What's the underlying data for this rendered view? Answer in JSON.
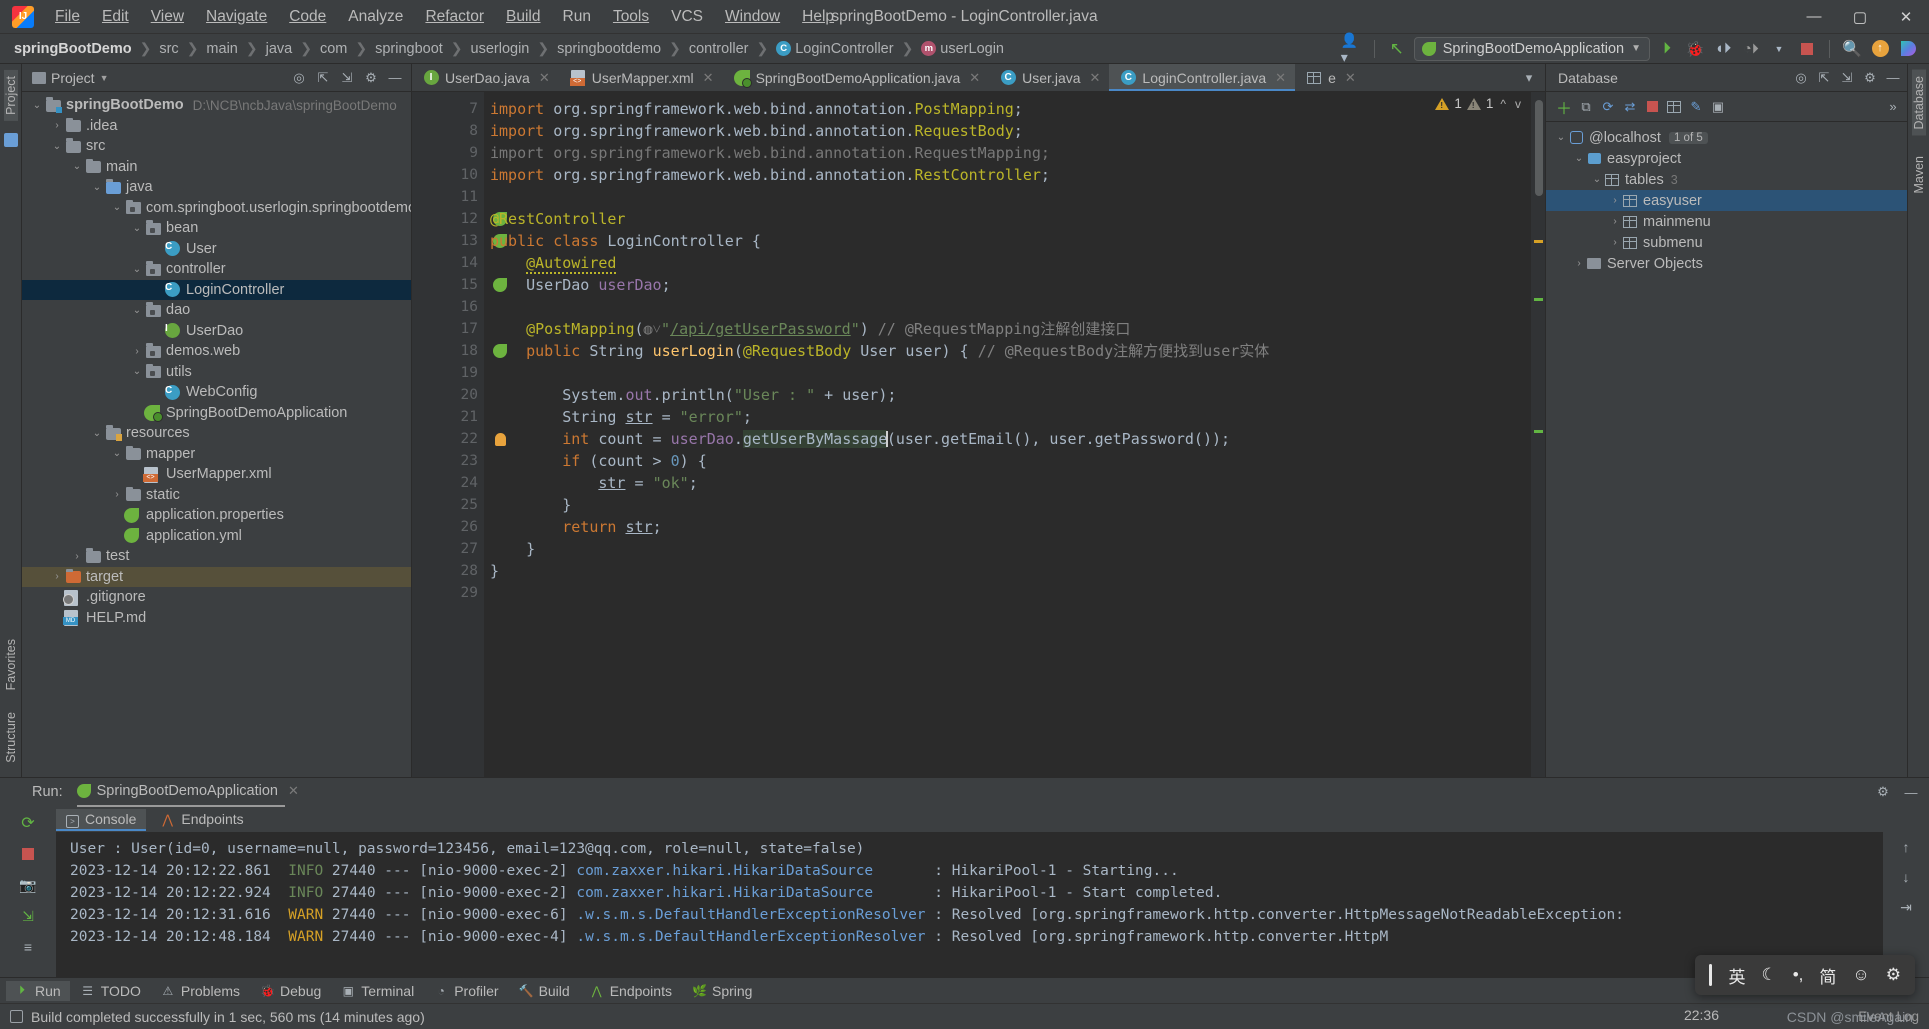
{
  "titlebar": {
    "window_title": "springBootDemo - LoginController.java",
    "menus": [
      "File",
      "Edit",
      "View",
      "Navigate",
      "Code",
      "Analyze",
      "Refactor",
      "Build",
      "Run",
      "Tools",
      "VCS",
      "Window",
      "Help"
    ],
    "controls": {
      "minimize": "—",
      "maximize": "▢",
      "close": "✕"
    }
  },
  "navbar": {
    "crumbs": [
      "springBootDemo",
      "src",
      "main",
      "java",
      "com",
      "springboot",
      "userlogin",
      "springbootdemo",
      "controller",
      "LoginController",
      "userLogin"
    ],
    "class_icon_letter": "C",
    "method_icon_letter": "m",
    "run_configuration": "SpringBootDemoApplication",
    "icons": [
      "user-dropdown-icon",
      "vcs-update-icon",
      "run-icon",
      "debug-icon",
      "run-coverage-icon",
      "profiler-icon",
      "stop-icon",
      "search-icon",
      "updates-icon",
      "ide-assistant-icon"
    ]
  },
  "left_strip": {
    "labels": [
      "Project",
      "Structure",
      "Favorites"
    ]
  },
  "right_strip": {
    "labels": [
      "Database",
      "Maven"
    ]
  },
  "project_panel": {
    "title": "Project",
    "toolbar_icons": [
      "locate-icon",
      "expand-all-icon",
      "collapse-all-icon",
      "settings-icon",
      "hide-icon"
    ],
    "tree": [
      {
        "depth": 0,
        "twist": "v",
        "icon": "module-folder",
        "label": "springBootDemo",
        "path": "D:\\NCB\\ncbJava\\springBootDemo",
        "bold": true
      },
      {
        "depth": 1,
        "twist": ">",
        "icon": "folder",
        "label": ".idea"
      },
      {
        "depth": 1,
        "twist": "v",
        "icon": "folder",
        "label": "src"
      },
      {
        "depth": 2,
        "twist": "v",
        "icon": "folder",
        "label": "main"
      },
      {
        "depth": 3,
        "twist": "v",
        "icon": "src-folder",
        "label": "java"
      },
      {
        "depth": 4,
        "twist": "v",
        "icon": "package",
        "label": "com.springboot.userlogin.springbootdemo"
      },
      {
        "depth": 5,
        "twist": "v",
        "icon": "package",
        "label": "bean"
      },
      {
        "depth": 6,
        "twist": "",
        "icon": "class",
        "label": "User"
      },
      {
        "depth": 5,
        "twist": "v",
        "icon": "package",
        "label": "controller"
      },
      {
        "depth": 6,
        "twist": "",
        "icon": "class",
        "label": "LoginController",
        "selected": true
      },
      {
        "depth": 5,
        "twist": "v",
        "icon": "package",
        "label": "dao"
      },
      {
        "depth": 6,
        "twist": "",
        "icon": "interface",
        "label": "UserDao"
      },
      {
        "depth": 5,
        "twist": ">",
        "icon": "package",
        "label": "demos.web"
      },
      {
        "depth": 5,
        "twist": "v",
        "icon": "package",
        "label": "utils"
      },
      {
        "depth": 6,
        "twist": "",
        "icon": "class",
        "label": "WebConfig"
      },
      {
        "depth": 5,
        "twist": "",
        "icon": "spring-app",
        "label": "SpringBootDemoApplication"
      },
      {
        "depth": 3,
        "twist": "v",
        "icon": "resources-folder",
        "label": "resources"
      },
      {
        "depth": 4,
        "twist": "v",
        "icon": "folder",
        "label": "mapper"
      },
      {
        "depth": 5,
        "twist": "",
        "icon": "xml",
        "label": "UserMapper.xml"
      },
      {
        "depth": 4,
        "twist": ">",
        "icon": "folder",
        "label": "static"
      },
      {
        "depth": 4,
        "twist": "",
        "icon": "properties",
        "label": "application.properties"
      },
      {
        "depth": 4,
        "twist": "",
        "icon": "properties",
        "label": "application.yml"
      },
      {
        "depth": 2,
        "twist": ">",
        "icon": "folder",
        "label": "test"
      },
      {
        "depth": 1,
        "twist": ">",
        "icon": "target-folder",
        "label": "target",
        "highlight": true
      },
      {
        "depth": 1,
        "twist": "",
        "icon": "gitignore",
        "label": ".gitignore"
      },
      {
        "depth": 1,
        "twist": "",
        "icon": "markdown",
        "label": "HELP.md"
      }
    ]
  },
  "editor": {
    "tabs": [
      {
        "label": "UserDao.java",
        "icon": "interface",
        "active": false
      },
      {
        "label": "UserMapper.xml",
        "icon": "xml",
        "active": false
      },
      {
        "label": "SpringBootDemoApplication.java",
        "icon": "spring-app",
        "active": false
      },
      {
        "label": "User.java",
        "icon": "class",
        "active": false
      },
      {
        "label": "LoginController.java",
        "icon": "class",
        "active": true
      },
      {
        "label": "e",
        "icon": "grid",
        "active": false
      }
    ],
    "hud": {
      "warning_count": "1",
      "weak_warning_count": "1",
      "up": "^",
      "down": "v"
    },
    "first_line_number": 7,
    "lines": [
      {
        "n": 7,
        "tokens": [
          {
            "t": "import ",
            "c": "k"
          },
          {
            "t": "org.springframework.web.bind.annotation.",
            "c": "pln"
          },
          {
            "t": "PostMapping",
            "c": "ann"
          },
          {
            "t": ";",
            "c": "pln"
          }
        ]
      },
      {
        "n": 8,
        "tokens": [
          {
            "t": "import ",
            "c": "k"
          },
          {
            "t": "org.springframework.web.bind.annotation.",
            "c": "pln"
          },
          {
            "t": "RequestBody",
            "c": "ann"
          },
          {
            "t": ";",
            "c": "pln"
          }
        ]
      },
      {
        "n": 9,
        "tokens": [
          {
            "t": "import org.springframework.web.bind.annotation.RequestMapping;",
            "c": "gry"
          }
        ]
      },
      {
        "n": 10,
        "tokens": [
          {
            "t": "import ",
            "c": "k"
          },
          {
            "t": "org.springframework.web.bind.annotation.",
            "c": "pln"
          },
          {
            "t": "RestController",
            "c": "ann"
          },
          {
            "t": ";",
            "c": "pln"
          }
        ],
        "fold": "minus"
      },
      {
        "n": 11,
        "tokens": []
      },
      {
        "n": 12,
        "tokens": [
          {
            "t": "@RestController",
            "c": "ann"
          }
        ],
        "gutter_icon": "spring-bean"
      },
      {
        "n": 13,
        "tokens": [
          {
            "t": "public class ",
            "c": "k"
          },
          {
            "t": "LoginController {",
            "c": "pln"
          }
        ],
        "gutter_icon": "spring-class"
      },
      {
        "n": 14,
        "tokens": [
          {
            "t": "    ",
            "c": "pln"
          },
          {
            "t": "@Autowired",
            "c": "ann wavy"
          }
        ]
      },
      {
        "n": 15,
        "tokens": [
          {
            "t": "    UserDao ",
            "c": "pln"
          },
          {
            "t": "userDao",
            "c": "fld"
          },
          {
            "t": ";",
            "c": "pln"
          }
        ],
        "gutter_icon": "spring-autowire"
      },
      {
        "n": 16,
        "tokens": []
      },
      {
        "n": 17,
        "tokens": [
          {
            "t": "    ",
            "c": "pln"
          },
          {
            "t": "@PostMapping",
            "c": "ann"
          },
          {
            "t": "(",
            "c": "pln"
          },
          {
            "t": "◍˅",
            "c": "gry"
          },
          {
            "t": "\"",
            "c": "str"
          },
          {
            "t": "/api/getUserPassword",
            "c": "str ul"
          },
          {
            "t": "\"",
            "c": "str"
          },
          {
            "t": ") ",
            "c": "pln"
          },
          {
            "t": "// @RequestMapping注解创建接口",
            "c": "cmt"
          }
        ]
      },
      {
        "n": 18,
        "tokens": [
          {
            "t": "    ",
            "c": "pln"
          },
          {
            "t": "public ",
            "c": "k"
          },
          {
            "t": "String ",
            "c": "pln"
          },
          {
            "t": "userLogin",
            "c": "mth"
          },
          {
            "t": "(",
            "c": "pln"
          },
          {
            "t": "@RequestBody",
            "c": "ann"
          },
          {
            "t": " User user) { ",
            "c": "pln"
          },
          {
            "t": "// @RequestBody注解方便找到user实体",
            "c": "cmt"
          }
        ],
        "gutter_icon": "spring-endpoint",
        "fold": "open"
      },
      {
        "n": 19,
        "tokens": []
      },
      {
        "n": 20,
        "tokens": [
          {
            "t": "        System.",
            "c": "pln"
          },
          {
            "t": "out",
            "c": "fld"
          },
          {
            "t": ".println(",
            "c": "pln"
          },
          {
            "t": "\"User : \"",
            "c": "str"
          },
          {
            "t": " + user);",
            "c": "pln"
          }
        ]
      },
      {
        "n": 21,
        "tokens": [
          {
            "t": "        String ",
            "c": "pln"
          },
          {
            "t": "str",
            "c": "pln ul"
          },
          {
            "t": " = ",
            "c": "pln"
          },
          {
            "t": "\"error\"",
            "c": "str"
          },
          {
            "t": ";",
            "c": "pln"
          }
        ]
      },
      {
        "n": 22,
        "tokens": [
          {
            "t": "        ",
            "c": "pln"
          },
          {
            "t": "int ",
            "c": "k"
          },
          {
            "t": "count = ",
            "c": "pln"
          },
          {
            "t": "userDao",
            "c": "fld"
          },
          {
            "t": ".",
            "c": "pln"
          },
          {
            "t": "getUserByMassage",
            "c": "pln hlsel"
          },
          {
            "t": "(user.getEmail(), user.getPassword());",
            "c": "pln"
          }
        ],
        "gutter_icon": "bulb",
        "caret": true
      },
      {
        "n": 23,
        "tokens": [
          {
            "t": "        ",
            "c": "pln"
          },
          {
            "t": "if ",
            "c": "k"
          },
          {
            "t": "(count > ",
            "c": "pln"
          },
          {
            "t": "0",
            "c": "num"
          },
          {
            "t": ") {",
            "c": "pln"
          }
        ],
        "fold": "open"
      },
      {
        "n": 24,
        "tokens": [
          {
            "t": "            ",
            "c": "pln"
          },
          {
            "t": "str",
            "c": "pln ul"
          },
          {
            "t": " = ",
            "c": "pln"
          },
          {
            "t": "\"ok\"",
            "c": "str"
          },
          {
            "t": ";",
            "c": "pln"
          }
        ]
      },
      {
        "n": 25,
        "tokens": [
          {
            "t": "        }",
            "c": "pln"
          }
        ],
        "fold": "close"
      },
      {
        "n": 26,
        "tokens": [
          {
            "t": "        ",
            "c": "pln"
          },
          {
            "t": "return ",
            "c": "k"
          },
          {
            "t": "str",
            "c": "pln ul"
          },
          {
            "t": ";",
            "c": "pln"
          }
        ]
      },
      {
        "n": 27,
        "tokens": [
          {
            "t": "    }",
            "c": "pln"
          }
        ],
        "fold": "close"
      },
      {
        "n": 28,
        "tokens": [
          {
            "t": "}",
            "c": "pln"
          }
        ]
      },
      {
        "n": 29,
        "tokens": []
      }
    ]
  },
  "database_panel": {
    "title": "Database",
    "toolbar_icons": [
      "add-icon",
      "copy-icon",
      "refresh-icon",
      "sync-icon",
      "stop-icon",
      "table-icon",
      "edit-icon",
      "console-icon",
      "more-icon"
    ],
    "tree": [
      {
        "depth": 0,
        "twist": "v",
        "icon": "db-connection",
        "label": "@localhost",
        "badge": "1 of 5"
      },
      {
        "depth": 1,
        "twist": "v",
        "icon": "schema",
        "label": "easyproject"
      },
      {
        "depth": 2,
        "twist": "v",
        "icon": "tables-group",
        "label": "tables",
        "badge_plain": "3"
      },
      {
        "depth": 3,
        "twist": ">",
        "icon": "table",
        "label": "easyuser",
        "selected": true
      },
      {
        "depth": 3,
        "twist": ">",
        "icon": "table",
        "label": "mainmenu"
      },
      {
        "depth": 3,
        "twist": ">",
        "icon": "table",
        "label": "submenu"
      },
      {
        "depth": 1,
        "twist": ">",
        "icon": "folder",
        "label": "Server Objects"
      }
    ]
  },
  "run_panel": {
    "label": "Run:",
    "configuration": "SpringBootDemoApplication",
    "tool_icons": [
      "rerun-icon",
      "stop-icon",
      "camera-icon",
      "thread-dump-icon",
      "filter-icon",
      "up-icon",
      "down-icon",
      "expand-icon"
    ],
    "subtabs": [
      {
        "label": "Console",
        "icon": "console-icon",
        "active": true
      },
      {
        "label": "Endpoints",
        "icon": "endpoints-icon",
        "active": false
      }
    ],
    "console_lines": [
      {
        "segments": [
          {
            "t": "User : User(id=0, username=null, password=123456, email=123@qq.com, role=null, state=false)",
            "c": "c-grey"
          }
        ]
      },
      {
        "segments": [
          {
            "t": "2023-12-14 20:12:22.861  ",
            "c": "c-grey"
          },
          {
            "t": "INFO",
            "c": "c-info"
          },
          {
            "t": " 27440 --- [nio-9000-exec-2] ",
            "c": "c-grey"
          },
          {
            "t": "com.zaxxer.hikari.HikariDataSource",
            "c": "c-blue"
          },
          {
            "t": "       : HikariPool-1 - Starting...",
            "c": "c-grey"
          }
        ]
      },
      {
        "segments": [
          {
            "t": "2023-12-14 20:12:22.924  ",
            "c": "c-grey"
          },
          {
            "t": "INFO",
            "c": "c-info"
          },
          {
            "t": " 27440 --- [nio-9000-exec-2] ",
            "c": "c-grey"
          },
          {
            "t": "com.zaxxer.hikari.HikariDataSource",
            "c": "c-blue"
          },
          {
            "t": "       : HikariPool-1 - Start completed.",
            "c": "c-grey"
          }
        ]
      },
      {
        "segments": [
          {
            "t": "2023-12-14 20:12:31.616  ",
            "c": "c-grey"
          },
          {
            "t": "WARN",
            "c": "c-warn"
          },
          {
            "t": " 27440 --- [nio-9000-exec-6] ",
            "c": "c-grey"
          },
          {
            "t": ".w.s.m.s.DefaultHandlerExceptionResolver",
            "c": "c-blue"
          },
          {
            "t": " : Resolved [org.springframework.http.converter.HttpMessageNotReadableException:",
            "c": "c-grey"
          }
        ]
      },
      {
        "segments": [
          {
            "t": "2023-12-14 20:12:48.184  ",
            "c": "c-grey"
          },
          {
            "t": "WARN",
            "c": "c-warn"
          },
          {
            "t": " 27440 --- [nio-9000-exec-4] ",
            "c": "c-grey"
          },
          {
            "t": ".w.s.m.s.DefaultHandlerExceptionResolver",
            "c": "c-blue"
          },
          {
            "t": " : Resolved [org.springframework.http.converter.HttpM",
            "c": "c-grey"
          }
        ]
      }
    ]
  },
  "bottom_bar": {
    "items": [
      {
        "label": "Run",
        "icon": "run-icon",
        "active": true
      },
      {
        "label": "TODO",
        "icon": "todo-icon"
      },
      {
        "label": "Problems",
        "icon": "problems-icon"
      },
      {
        "label": "Debug",
        "icon": "debug-icon"
      },
      {
        "label": "Terminal",
        "icon": "terminal-icon"
      },
      {
        "label": "Profiler",
        "icon": "profiler-icon"
      },
      {
        "label": "Build",
        "icon": "build-icon"
      },
      {
        "label": "Endpoints",
        "icon": "endpoints-icon"
      },
      {
        "label": "Spring",
        "icon": "spring-icon"
      }
    ]
  },
  "status_bar": {
    "message": "Build completed successfully in 1 sec, 560 ms (14 minutes ago)",
    "clock": "22:36",
    "event_log": "Event Log"
  },
  "ime_bar": {
    "items": [
      "英",
      "☾",
      "•,",
      "简",
      "☺",
      "⚙"
    ]
  },
  "watermark": "CSDN @smileAgain"
}
